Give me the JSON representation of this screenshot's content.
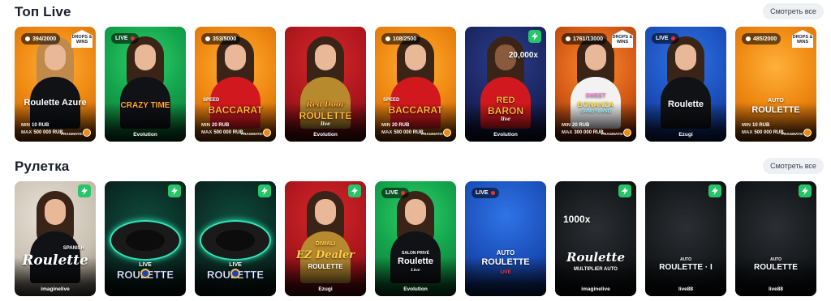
{
  "sections": [
    {
      "title": "Топ Live",
      "see_all": "Смотреть все",
      "cards": [
        {
          "seats": "394/2000",
          "badge": "drops",
          "badge_text": "DROPS & WINS",
          "logo": "Roulette Azure",
          "limits": {
            "min": "10 RUB",
            "max": "500 000 RUB"
          },
          "provider_mini": "PRAGMATIC"
        },
        {
          "live": "LIVE",
          "logo": "CRAZY TIME",
          "provider": "Evolution"
        },
        {
          "seats": "353/5000",
          "logo_top": "SPEED",
          "logo": "BACCARAT",
          "limits": {
            "min": "20 RUB",
            "max": "500 000 RUB"
          },
          "provider_mini": "PRAGMATIC"
        },
        {
          "logo_top": "Red Door",
          "logo": "ROULETTE",
          "logo_bottom": "live",
          "provider": "Evolution"
        },
        {
          "seats": "108/2500",
          "logo_top": "SPEED",
          "logo": "BACCARAT",
          "limits": {
            "min": "20 RUB",
            "max": "500 000 RUB"
          },
          "provider_mini": "PRAGMATIC"
        },
        {
          "bolt": true,
          "multiplier": "20,000x",
          "logo_top": "RED",
          "logo": "BARON",
          "logo_bottom": "live",
          "provider": "Evolution"
        },
        {
          "seats": "1761/13000",
          "badge": "drops",
          "badge_text": "DROPS & WINS",
          "logo_top": "SWEET",
          "logo": "BONANZA",
          "logo_bottom": "CANDYLAND",
          "limits": {
            "min": "20 RUB",
            "max": "300 000 RUB"
          },
          "provider_mini": "PRAGMATIC"
        },
        {
          "live": "LIVE",
          "logo": "Roulette",
          "provider": "Ezugi"
        },
        {
          "seats": "485/2000",
          "badge": "drops",
          "badge_text": "DROPS & WINS",
          "logo_top": "AUTO",
          "logo": "ROULETTE",
          "limits": {
            "min": "10 RUB",
            "max": "500 000 RUB"
          },
          "provider_mini": "PRAGMATIC"
        }
      ]
    },
    {
      "title": "Рулетка",
      "see_all": "Смотреть все",
      "cards": [
        {
          "bolt": true,
          "logo_top": "SPANISH",
          "logo": "Roulette",
          "provider": "imaginelive"
        },
        {
          "bolt": true,
          "logo_top": "LIVE",
          "logo": "ROULETTE"
        },
        {
          "bolt": true,
          "logo_top": "LIVE",
          "logo": "ROULETTE"
        },
        {
          "bolt": true,
          "logo_top": "DIWALI",
          "logo": "EZ Dealer",
          "logo_bottom": "ROULETTE",
          "provider": "Ezugi"
        },
        {
          "live": "LIVE",
          "logo_top": "SALON PRIVÉ",
          "logo": "Roulette",
          "logo_bottom": "Live",
          "provider": "Evolution"
        },
        {
          "live": "LIVE",
          "logo_top": "AUTO",
          "logo": "ROULETTE",
          "logo_bottom": "LIVE"
        },
        {
          "bolt": true,
          "multiplier": "1000x",
          "logo": "Roulette",
          "logo_bottom": "MULTIPLIER AUTO",
          "provider": "imaginelive"
        },
        {
          "bolt": true,
          "logo_top": "AUTO",
          "logo": "ROULETTE · I",
          "provider": "live88"
        },
        {
          "bolt": true,
          "logo_top": "AUTO",
          "logo": "ROULETTE",
          "provider": "live88"
        }
      ]
    }
  ],
  "labels": {
    "min": "MIN",
    "max": "MAX"
  }
}
